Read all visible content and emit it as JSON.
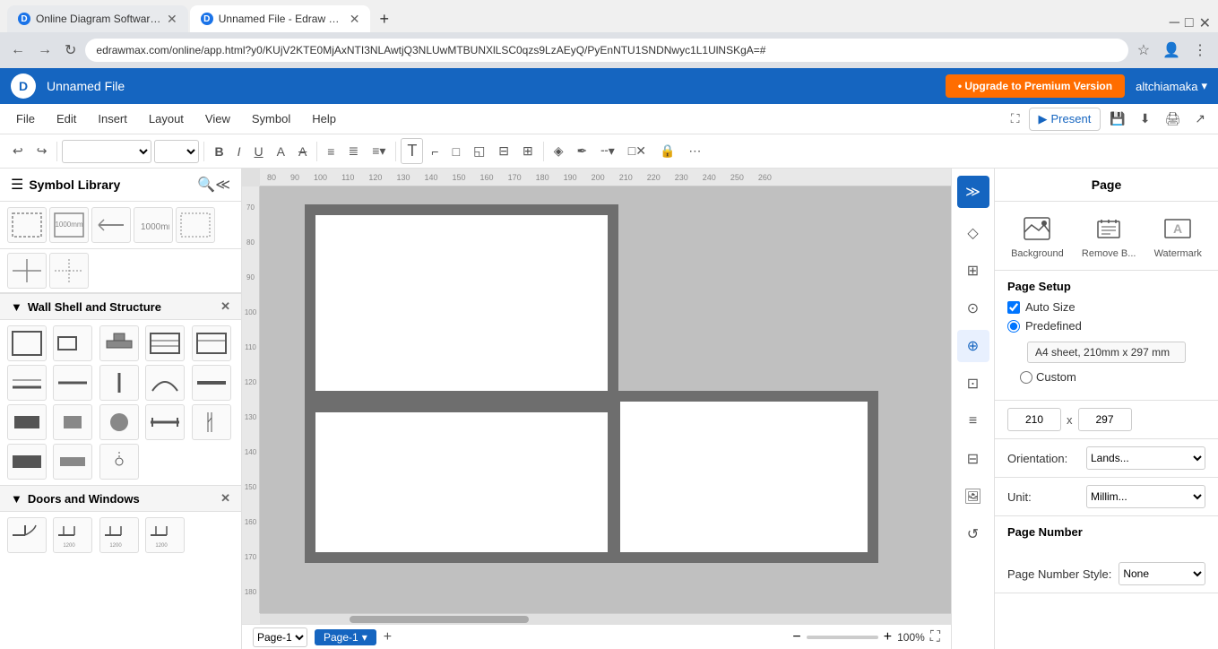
{
  "browser": {
    "tabs": [
      {
        "label": "Online Diagram Software - Edra...",
        "active": false,
        "icon": "D"
      },
      {
        "label": "Unnamed File - Edraw Max",
        "active": true,
        "icon": "D"
      }
    ],
    "address": "edrawmax.com/online/app.html?y0/KUjV2KTE0MjAxNTI3NLAwtjQ3NLUwMTBUNXlLSC0qzs9LzAEyQ/PyEnNTU1SNDNwyc1L1UlNSKgA=#",
    "new_tab_label": "+"
  },
  "app": {
    "title": "Unnamed File",
    "upgrade_btn": "Upgrade to Premium Version",
    "user": "altchiamaka"
  },
  "menu": {
    "items": [
      "File",
      "Edit",
      "Insert",
      "Layout",
      "View",
      "Symbol",
      "Help"
    ],
    "present_btn": "Present"
  },
  "toolbar": {
    "undo_label": "↩",
    "redo_label": "↪",
    "font_family": "",
    "font_size": "",
    "bold": "B",
    "italic": "I",
    "underline": "U",
    "font_color": "A",
    "strikethrough": "S̶",
    "align_left": "≡",
    "align_center": "≡",
    "format": "≡"
  },
  "sidebar": {
    "title": "Symbol Library",
    "sections": [
      {
        "label": "Wall Shell and Structure",
        "items": [
          "□",
          "⊏",
          "⊓",
          "⊟",
          "⊡",
          "⊤",
          "─",
          "┤",
          "⌒",
          "═",
          "■",
          "▪",
          "●",
          "━",
          "✛",
          "■",
          "▪",
          "○"
        ]
      },
      {
        "label": "Doors and Windows",
        "items": [
          "⊢",
          "⊢",
          "⊢",
          "⊢"
        ]
      }
    ]
  },
  "right_strip": {
    "buttons": [
      {
        "icon": "≫",
        "name": "expand",
        "active": true
      },
      {
        "icon": "◇",
        "name": "style"
      },
      {
        "icon": "⊞",
        "name": "format"
      },
      {
        "icon": "⊙",
        "name": "insert"
      },
      {
        "icon": "⊕",
        "name": "layers"
      },
      {
        "icon": "⊡",
        "name": "map"
      },
      {
        "icon": "≡",
        "name": "properties"
      },
      {
        "icon": "⊞",
        "name": "page"
      },
      {
        "icon": "⊟",
        "name": "export"
      },
      {
        "icon": "↺",
        "name": "history"
      }
    ]
  },
  "right_panel": {
    "title": "Page",
    "icons": [
      {
        "label": "Background",
        "icon": "◇"
      },
      {
        "label": "Remove B...",
        "icon": "🗑"
      },
      {
        "label": "Watermark",
        "icon": "A"
      }
    ],
    "page_setup": {
      "title": "Page Setup",
      "auto_size_label": "Auto Size",
      "auto_size_checked": true,
      "predefined_label": "Predefined",
      "predefined_checked": true,
      "preset_value": "A4 sheet, 210mm x 297 mm",
      "custom_label": "Custom",
      "width_value": "210",
      "height_value": "297",
      "x_label": "x",
      "orientation_label": "Orientation:",
      "orientation_value": "Lands...",
      "unit_label": "Unit:",
      "unit_value": "Millim..."
    },
    "page_number": {
      "title": "Page Number",
      "style_label": "Page Number Style:",
      "style_value": "None"
    }
  },
  "canvas": {
    "ruler_ticks_h": [
      "80",
      "90",
      "100",
      "110",
      "120",
      "130",
      "140",
      "150",
      "160",
      "170",
      "180",
      "190",
      "200",
      "210",
      "220",
      "230",
      "240",
      "250",
      "260"
    ],
    "ruler_ticks_v": [
      "70",
      "80",
      "90",
      "100",
      "110",
      "120",
      "130",
      "140",
      "150",
      "160",
      "170",
      "180"
    ]
  },
  "bottom_bar": {
    "page_dropdown": "Page-1",
    "active_page": "Page-1",
    "add_page": "+",
    "zoom_minus": "−",
    "zoom_plus": "+",
    "zoom_value": "100%",
    "fullscreen": "⛶"
  }
}
